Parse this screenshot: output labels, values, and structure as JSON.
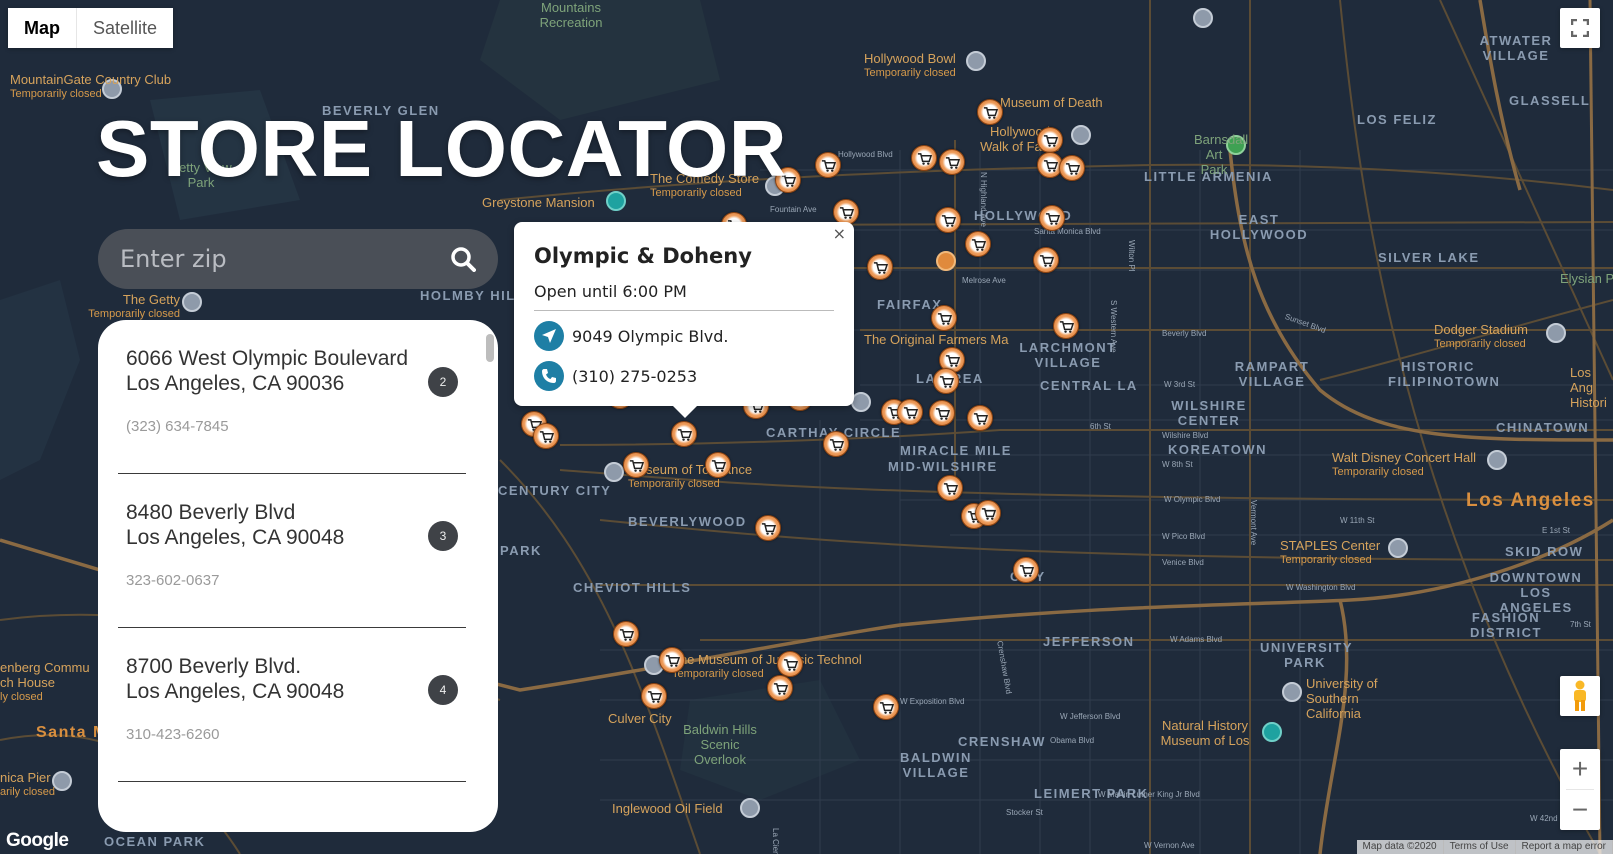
{
  "page_title": "STORE LOCATOR",
  "search": {
    "placeholder": "Enter zip"
  },
  "map_controls": {
    "map_label": "Map",
    "satellite_label": "Satellite",
    "zoom_in": "+",
    "zoom_out": "−",
    "google": "Google",
    "attribution": [
      "Map data ©2020",
      "Terms of Use",
      "Report a map error"
    ]
  },
  "stores": [
    {
      "line1": "6066 West Olympic Boulevard",
      "line2": "Los Angeles, CA 90036",
      "phone": "(323) 634-7845",
      "number": "2"
    },
    {
      "line1": "8480 Beverly Blvd",
      "line2": "Los Angeles, CA 90048",
      "phone": "323-602-0637",
      "number": "3"
    },
    {
      "line1": "8700 Beverly Blvd.",
      "line2": "Los Angeles, CA 90048",
      "phone": "310-423-6260",
      "number": "4"
    }
  ],
  "info_window": {
    "name": "Olympic & Doheny",
    "hours": "Open until 6:00 PM",
    "address": "9049 Olympic Blvd.",
    "phone": "(310) 275-0253",
    "close": "×"
  },
  "map_labels": {
    "areas": [
      "BEVERLY GLEN",
      "HOLMBY HILLS",
      "HOLLYWOOD",
      "LOS FELIZ",
      "ATWATER VILLAGE",
      "GLASSELL",
      "LITTLE ARMENIA",
      "EAST HOLLYWOOD",
      "SILVER LAKE",
      "FAIRFAX",
      "LARCHMONT VILLAGE",
      "RAMPART VILLAGE",
      "HISTORIC FILIPINOTOWN",
      "CENTRAL LA",
      "WILSHIRE CENTER",
      "KOREATOWN",
      "CHINATOWN",
      "LA BREA",
      "CARTHAY CIRCLE",
      "MIRACLE MILE",
      "MID-WILSHIRE",
      "CENTURY CITY",
      "BEVERLYWOOD",
      "CHEVIOT HILLS",
      "JEFFERSON",
      "UNIVERSITY PARK",
      "SKID ROW",
      "DOWNTOWN LOS ANGELES",
      "FASHION DISTRICT",
      "CRENSHAW",
      "BALDWIN VILLAGE",
      "LEIMERT PARK",
      "OCEAN PARK",
      "PARK",
      "CITY"
    ],
    "city": "Los Angeles",
    "pois": [
      {
        "name": "MountainGate Country Club",
        "status": "Temporarily closed"
      },
      {
        "name": "Hollywood Bowl",
        "status": "Temporarily closed"
      },
      {
        "name": "Museum of Death",
        "status": ""
      },
      {
        "name": "Hollywood Walk of Fame",
        "status": ""
      },
      {
        "name": "Barnsdall Art Park",
        "status": ""
      },
      {
        "name": "Greystone Mansion",
        "status": ""
      },
      {
        "name": "The Comedy Store",
        "status": "Temporarily closed"
      },
      {
        "name": "The Getty",
        "status": "Temporarily closed"
      },
      {
        "name": "The Original Farmers Ma",
        "status": ""
      },
      {
        "name": "Dodger Stadium",
        "status": "Temporarily closed"
      },
      {
        "name": "Walt Disney Concert Hall",
        "status": "Temporarily closed"
      },
      {
        "name": "Museum of Tolerance",
        "status": "Temporarily closed"
      },
      {
        "name": "STAPLES Center",
        "status": "Temporarily closed"
      },
      {
        "name": "The Museum of Jurassic Technol",
        "status": "Temporarily closed"
      },
      {
        "name": "University of Southern California",
        "status": ""
      },
      {
        "name": "Natural History Museum of Los",
        "status": ""
      },
      {
        "name": "Culver City",
        "status": ""
      },
      {
        "name": "Baldwin Hills Scenic Overlook",
        "status": ""
      },
      {
        "name": "Inglewood Oil Field",
        "status": ""
      },
      {
        "name": "Santa M",
        "status": ""
      },
      {
        "name": "nica Pier",
        "status": "arily closed"
      },
      {
        "name": "enberg Commu ch House",
        "status": "ly closed"
      },
      {
        "name": "Mountains Recreation",
        "status": ""
      },
      {
        "name": "Betty View Park",
        "status": ""
      },
      {
        "name": "Los Ang Histori",
        "status": ""
      },
      {
        "name": "Elysian Park",
        "status": ""
      }
    ],
    "streets": [
      "Sunset Blvd",
      "Santa Monica Blvd",
      "Melrose Ave",
      "Beverly Blvd",
      "W 3rd St",
      "Wilshire Blvd",
      "W Olympic Blvd",
      "W Pico Blvd",
      "Venice Blvd",
      "W Washington Blvd",
      "W Adams Blvd",
      "W Jefferson Blvd",
      "W Exposition Blvd",
      "Obama Blvd",
      "W Martin Luther King Jr Blvd",
      "W Vernon Ave",
      "S Western Ave",
      "Vermont Ave",
      "N Highland Ave",
      "La Cienega",
      "Fountain Ave",
      "Hollywood Blvd",
      "6th St",
      "W 8th St",
      "W 11th St",
      "E 1st St",
      "7th St",
      "W 42nd St",
      "Stocker St",
      "Wilton Pl",
      "Crenshaw Blvd"
    ]
  },
  "colors": {
    "map_bg": "#1f2b3b",
    "road": "#6b5a3c",
    "highway": "#a3794b",
    "marker": "#e98e3c",
    "info_icon": "#1e7fa5",
    "search_bg": "#4a4f57"
  }
}
